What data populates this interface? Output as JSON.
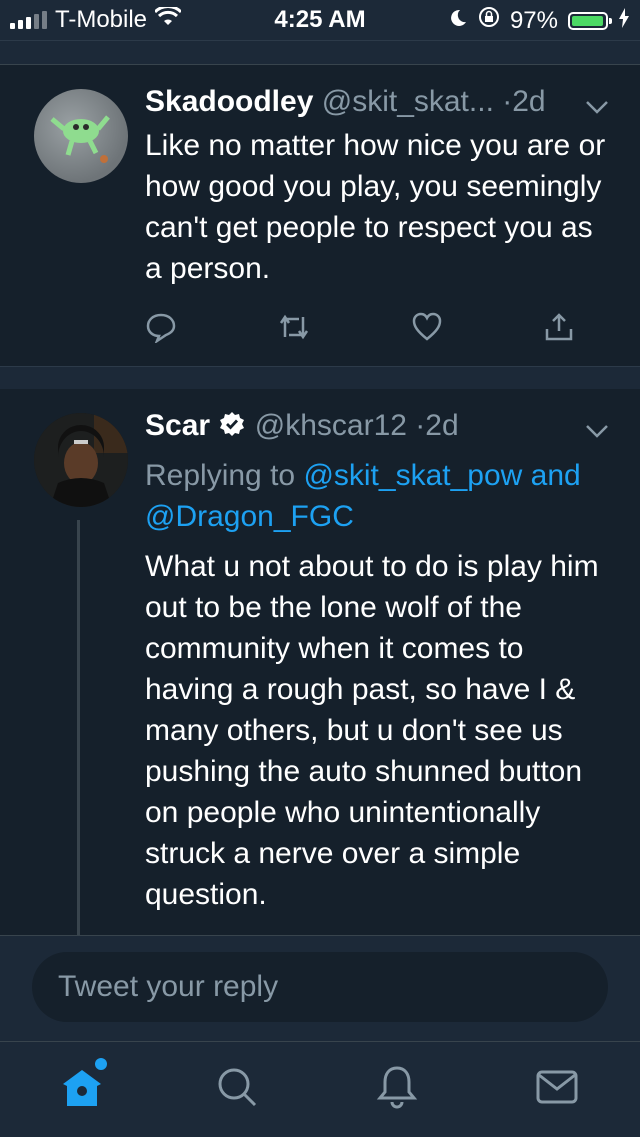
{
  "status_bar": {
    "carrier": "T-Mobile",
    "time": "4:25 AM",
    "battery_percent": "97%",
    "battery_level": 0.97
  },
  "tweets": [
    {
      "name": "Skadoodley",
      "handle": "@skit_skat...",
      "separator": "·",
      "time": "2d",
      "text": "Like no matter how nice you are or how good you play, you seemingly can't get people to respect you as a person."
    },
    {
      "name": "Scar",
      "verified": true,
      "handle": "@khscar12",
      "separator": "·",
      "time": "2d",
      "replying_prefix": "Replying to",
      "replying_to_1": "@skit_skat_pow",
      "replying_and": "and",
      "replying_to_2": "@Dragon_FGC",
      "text": "What u not about to do is play him out to be the lone wolf of the community when it comes to having a rough past, so have I & many others, but u don't see us pushing the auto shunned button on people who unintentionally struck a nerve over a simple question."
    }
  ],
  "reply_bar": {
    "placeholder": "Tweet your reply"
  },
  "tab_bar": {
    "tabs": [
      "home-icon",
      "search-icon",
      "bell-icon",
      "mail-icon"
    ],
    "home_has_notification": true
  },
  "colors": {
    "background": "#15202b",
    "bar_background": "#1c2938",
    "accent": "#1da1f2",
    "muted": "#8899a6",
    "battery": "#4cd964"
  }
}
